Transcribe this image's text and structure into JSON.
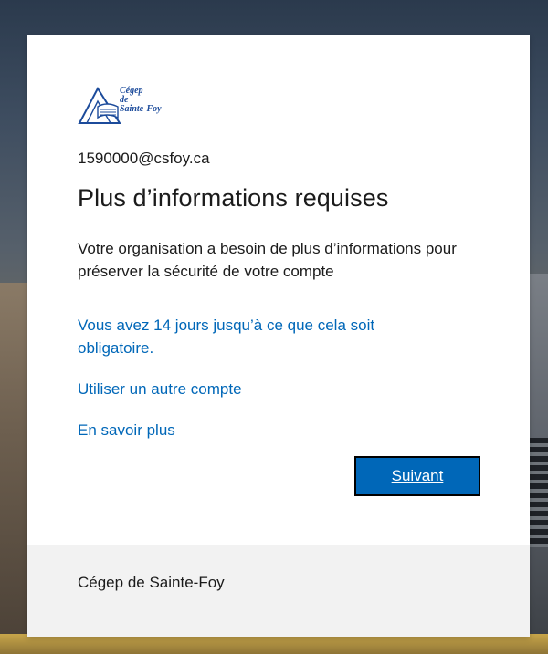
{
  "organization": {
    "logo_text": "Cégep\nde\nSainte-Foy",
    "brand_color": "#1c4b9b"
  },
  "account": {
    "email": "1590000@csfoy.ca"
  },
  "dialog": {
    "title": "Plus d’informations requises",
    "description": "Votre organisation a besoin de plus d’informations pour préserver la sécurité de votre compte",
    "deadline_link": "Vous avez 14 jours jusqu’à ce que cela soit obligatoire.",
    "other_account_link": "Utiliser un autre compte",
    "learn_more_link": "En savoir plus",
    "next_button": "Suivant"
  },
  "footer": {
    "text": "Cégep de Sainte-Foy"
  },
  "colors": {
    "link": "#0067b8",
    "button_bg": "#0067b8",
    "footer_bg": "#f2f2f2",
    "text": "#1b1b1b"
  }
}
